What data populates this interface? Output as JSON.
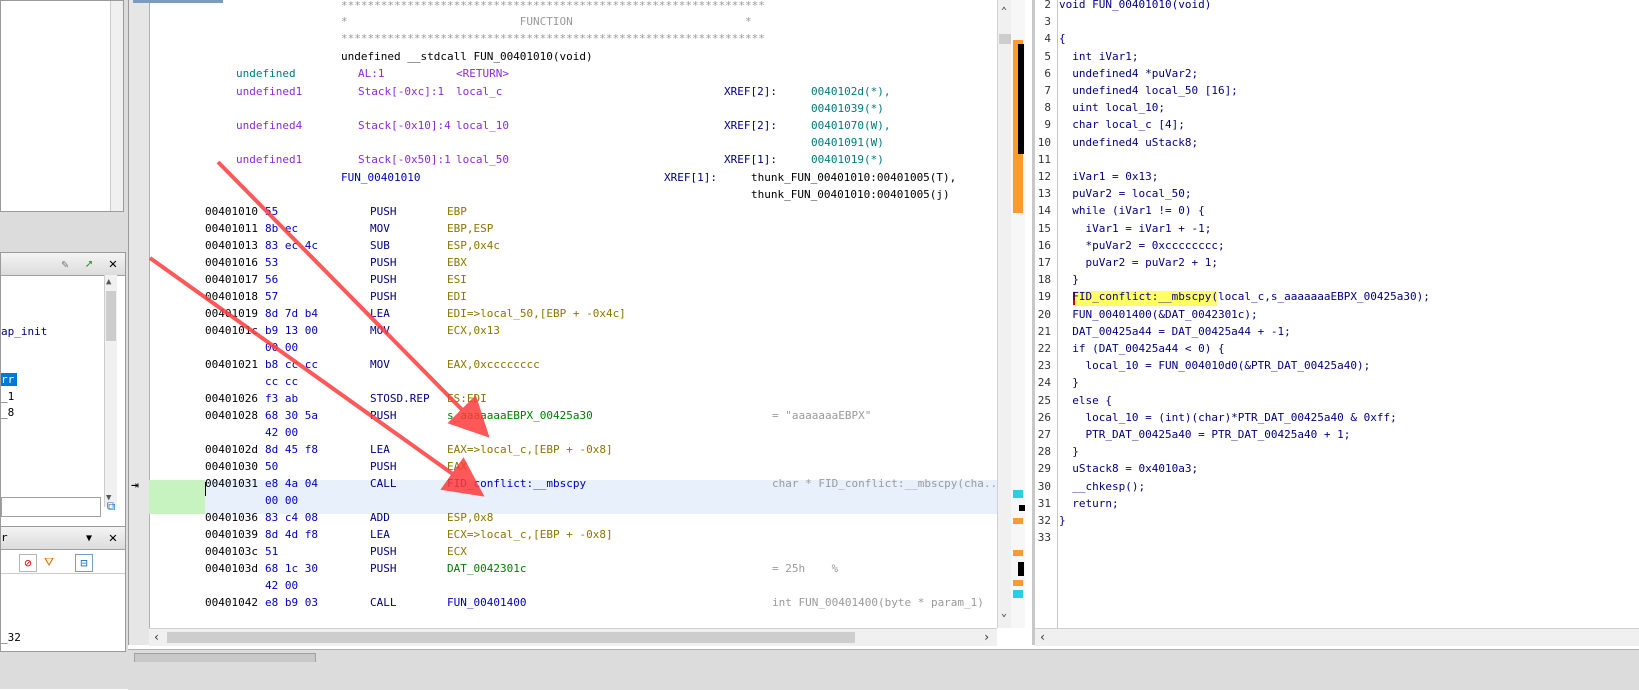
{
  "colors": {
    "accent": "#0078d7",
    "highlight_green": "#c6f3c0",
    "current_row": "#e8f0fb",
    "yellow_highlight": "#ffff66",
    "arrow": "#ff3b3b",
    "marker_orange": "#ff8c1a",
    "marker_cyan": "#27d0e0"
  },
  "left": {
    "symbol_fragments": {
      "ap_init": "ap_init",
      "selected": "rr",
      "frag1": "_1",
      "frag2": "_8",
      "frag3": "r",
      "frag4": "_32"
    },
    "icons": [
      "pencil-icon",
      "arrow-green-icon",
      "close-icon",
      "chevron-down-icon",
      "no-filter-icon",
      "filter-icon",
      "collapse-icon"
    ]
  },
  "listing": {
    "header": {
      "stars_top": "****************************************************************",
      "function_label": "*                          FUNCTION                          *",
      "stars_bottom": "****************************************************************",
      "signature": "undefined __stdcall FUN_00401010(void)"
    },
    "vars": [
      {
        "type": "undefined",
        "storage": "AL:1",
        "name": "<RETURN>",
        "xref_label": "",
        "xref": ""
      },
      {
        "type": "undefined1",
        "storage": "Stack[-0xc]:1",
        "name": "local_c",
        "xref_label": "XREF[2]:",
        "xref": "0040102d(*),"
      },
      {
        "type": "",
        "storage": "",
        "name": "",
        "xref_label": "",
        "xref": "00401039(*)"
      },
      {
        "type": "undefined4",
        "storage": "Stack[-0x10]:4",
        "name": "local_10",
        "xref_label": "XREF[2]:",
        "xref": "00401070(W),"
      },
      {
        "type": "",
        "storage": "",
        "name": "",
        "xref_label": "",
        "xref": "00401091(W)"
      },
      {
        "type": "undefined1",
        "storage": "Stack[-0x50]:1",
        "name": "local_50",
        "xref_label": "XREF[1]:",
        "xref": "00401019(*)"
      }
    ],
    "label_line": {
      "label": "FUN_00401010",
      "xref_label": "XREF[1]:",
      "xref1": "thunk_FUN_00401010:00401005(T),",
      "xref2": "thunk_FUN_00401010:00401005(j)"
    },
    "instructions": [
      {
        "addr": "00401010",
        "bytes": "55",
        "mnem": "PUSH",
        "ops": "EBP",
        "comment": ""
      },
      {
        "addr": "00401011",
        "bytes": "8b ec",
        "mnem": "MOV",
        "ops": "EBP,ESP",
        "comment": ""
      },
      {
        "addr": "00401013",
        "bytes": "83 ec 4c",
        "mnem": "SUB",
        "ops": "ESP,0x4c",
        "comment": ""
      },
      {
        "addr": "00401016",
        "bytes": "53",
        "mnem": "PUSH",
        "ops": "EBX",
        "comment": ""
      },
      {
        "addr": "00401017",
        "bytes": "56",
        "mnem": "PUSH",
        "ops": "ESI",
        "comment": ""
      },
      {
        "addr": "00401018",
        "bytes": "57",
        "mnem": "PUSH",
        "ops": "EDI",
        "comment": ""
      },
      {
        "addr": "00401019",
        "bytes": "8d 7d b4",
        "mnem": "LEA",
        "ops": "EDI=>local_50,[EBP + -0x4c]",
        "comment": ""
      },
      {
        "addr": "0040101c",
        "bytes": "b9 13 00",
        "mnem": "MOV",
        "ops": "ECX,0x13",
        "comment": ""
      },
      {
        "addr": "",
        "bytes": "00 00",
        "mnem": "",
        "ops": "",
        "comment": ""
      },
      {
        "addr": "00401021",
        "bytes": "b8 cc cc",
        "mnem": "MOV",
        "ops": "EAX,0xcccccccc",
        "comment": ""
      },
      {
        "addr": "",
        "bytes": "cc cc",
        "mnem": "",
        "ops": "",
        "comment": ""
      },
      {
        "addr": "00401026",
        "bytes": "f3 ab",
        "mnem": "STOSD.REP",
        "ops": "ES:EDI",
        "comment": ""
      },
      {
        "addr": "00401028",
        "bytes": "68 30 5a",
        "mnem": "PUSH",
        "ops": "s_aaaaaaaEBPX_00425a30",
        "comment": "= \"aaaaaaaEBPX\""
      },
      {
        "addr": "",
        "bytes": "42 00",
        "mnem": "",
        "ops": "",
        "comment": ""
      },
      {
        "addr": "0040102d",
        "bytes": "8d 45 f8",
        "mnem": "LEA",
        "ops": "EAX=>local_c,[EBP + -0x8]",
        "comment": ""
      },
      {
        "addr": "00401030",
        "bytes": "50",
        "mnem": "PUSH",
        "ops": "EAX",
        "comment": ""
      },
      {
        "addr": "00401031",
        "bytes": "e8 4a 04",
        "mnem": "CALL",
        "ops": "FID_conflict:__mbscpy",
        "comment": "char * FID_conflict:__mbscpy(cha..."
      },
      {
        "addr": "",
        "bytes": "00 00",
        "mnem": "",
        "ops": "",
        "comment": ""
      },
      {
        "addr": "00401036",
        "bytes": "83 c4 08",
        "mnem": "ADD",
        "ops": "ESP,0x8",
        "comment": ""
      },
      {
        "addr": "00401039",
        "bytes": "8d 4d f8",
        "mnem": "LEA",
        "ops": "ECX=>local_c,[EBP + -0x8]",
        "comment": ""
      },
      {
        "addr": "0040103c",
        "bytes": "51",
        "mnem": "PUSH",
        "ops": "ECX",
        "comment": ""
      },
      {
        "addr": "0040103d",
        "bytes": "68 1c 30",
        "mnem": "PUSH",
        "ops": "DAT_0042301c",
        "comment": "= 25h    %"
      },
      {
        "addr": "",
        "bytes": "42 00",
        "mnem": "",
        "ops": "",
        "comment": ""
      },
      {
        "addr": "00401042",
        "bytes": "e8 b9 03",
        "mnem": "CALL",
        "ops": "FUN_00401400",
        "comment": "int FUN_00401400(byte * param_1)"
      }
    ]
  },
  "decompiler": {
    "lines": [
      {
        "n": "2",
        "text": "void FUN_00401010(void)"
      },
      {
        "n": "3",
        "text": ""
      },
      {
        "n": "4",
        "text": "{"
      },
      {
        "n": "5",
        "text": "  int iVar1;"
      },
      {
        "n": "6",
        "text": "  undefined4 *puVar2;"
      },
      {
        "n": "7",
        "text": "  undefined4 local_50 [16];"
      },
      {
        "n": "8",
        "text": "  uint local_10;"
      },
      {
        "n": "9",
        "text": "  char local_c [4];"
      },
      {
        "n": "10",
        "text": "  undefined4 uStack8;"
      },
      {
        "n": "11",
        "text": ""
      },
      {
        "n": "12",
        "text": "  iVar1 = 0x13;"
      },
      {
        "n": "13",
        "text": "  puVar2 = local_50;"
      },
      {
        "n": "14",
        "text": "  while (iVar1 != 0) {"
      },
      {
        "n": "15",
        "text": "    iVar1 = iVar1 + -1;"
      },
      {
        "n": "16",
        "text": "    *puVar2 = 0xcccccccc;"
      },
      {
        "n": "17",
        "text": "    puVar2 = puVar2 + 1;"
      },
      {
        "n": "18",
        "text": "  }"
      },
      {
        "n": "19",
        "text": "  FID_conflict:__mbscpy(local_c,s_aaaaaaaEBPX_00425a30);"
      },
      {
        "n": "20",
        "text": "  FUN_00401400(&DAT_0042301c);"
      },
      {
        "n": "21",
        "text": "  DAT_00425a44 = DAT_00425a44 + -1;"
      },
      {
        "n": "22",
        "text": "  if (DAT_00425a44 < 0) {"
      },
      {
        "n": "23",
        "text": "    local_10 = FUN_004010d0(&PTR_DAT_00425a40);"
      },
      {
        "n": "24",
        "text": "  }"
      },
      {
        "n": "25",
        "text": "  else {"
      },
      {
        "n": "26",
        "text": "    local_10 = (int)(char)*PTR_DAT_00425a40 & 0xff;"
      },
      {
        "n": "27",
        "text": "    PTR_DAT_00425a40 = PTR_DAT_00425a40 + 1;"
      },
      {
        "n": "28",
        "text": "  }"
      },
      {
        "n": "29",
        "text": "  uStack8 = 0x4010a3;"
      },
      {
        "n": "30",
        "text": "  __chkesp();"
      },
      {
        "n": "31",
        "text": "  return;"
      },
      {
        "n": "32",
        "text": "}"
      },
      {
        "n": "33",
        "text": ""
      }
    ]
  }
}
